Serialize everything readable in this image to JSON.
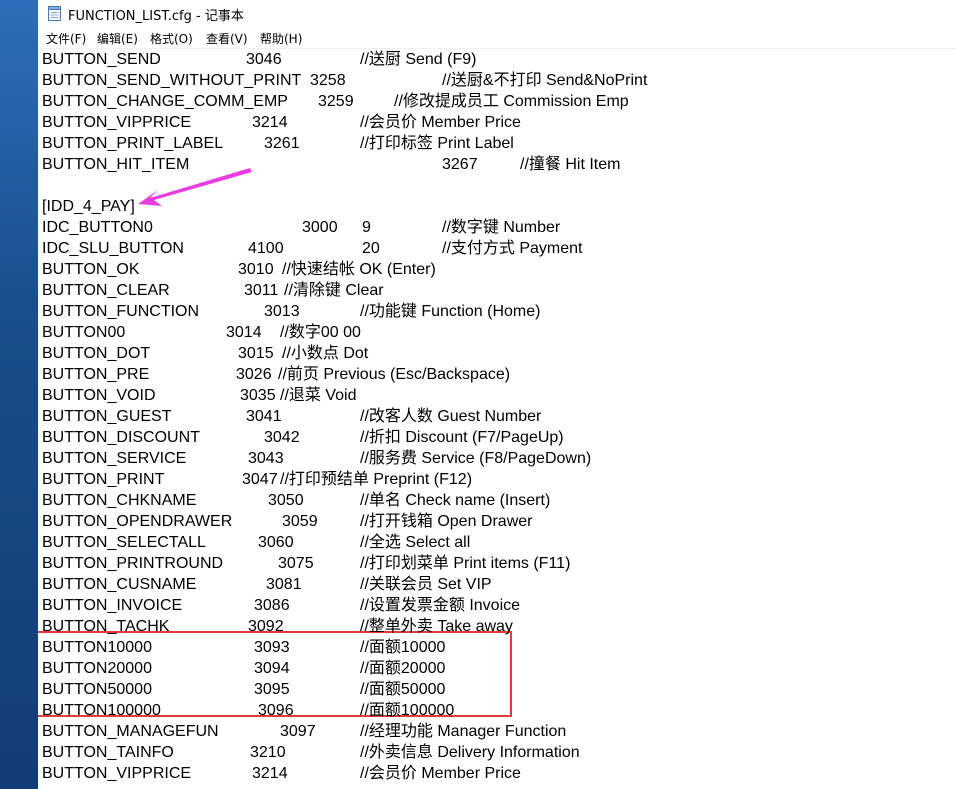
{
  "window": {
    "title": "FUNCTION_LIST.cfg - 记事本"
  },
  "menu": [
    "文件(F)",
    "编辑(E)",
    "格式(O)",
    "查看(V)",
    "帮助(H)"
  ],
  "lines": [
    [
      "BUTTON_SEND",
      "3046",
      "",
      "//送厨 Send (F9)"
    ],
    [
      "BUTTON_SEND_WITHOUT_PRINT",
      "3258",
      "",
      "//送厨&不打印 Send&NoPrint"
    ],
    [
      "BUTTON_CHANGE_COMM_EMP",
      "3259",
      "",
      "//修改提成员工 Commission Emp"
    ],
    [
      "BUTTON_VIPPRICE",
      "3214",
      "",
      "//会员价  Member Price"
    ],
    [
      "BUTTON_PRINT_LABEL",
      "3261",
      "",
      "//打印标签 Print Label"
    ],
    [
      "BUTTON_HIT_ITEM",
      "3267",
      "",
      "//撞餐 Hit Item"
    ],
    [
      "",
      "",
      "",
      ""
    ],
    [
      "[IDD_4_PAY]",
      "",
      "",
      ""
    ],
    [
      "IDC_BUTTON0",
      "3000",
      "9",
      "//数字键 Number"
    ],
    [
      "IDC_SLU_BUTTON",
      "4100",
      "20",
      "//支付方式 Payment"
    ],
    [
      "BUTTON_OK",
      "3010",
      "",
      "//快速结帐  OK (Enter)"
    ],
    [
      "BUTTON_CLEAR",
      "3011",
      "",
      "//清除键  Clear"
    ],
    [
      "BUTTON_FUNCTION",
      "3013",
      "",
      "//功能键  Function (Home)"
    ],
    [
      "BUTTON00",
      "3014",
      "",
      "//数字00  00"
    ],
    [
      "BUTTON_DOT",
      "3015",
      "",
      "//小数点  Dot"
    ],
    [
      "BUTTON_PRE",
      "3026",
      "",
      "//前页   Previous (Esc/Backspace)"
    ],
    [
      "BUTTON_VOID",
      "3035",
      "",
      "//退菜  Void"
    ],
    [
      "BUTTON_GUEST",
      "3041",
      "",
      "//改客人数  Guest Number"
    ],
    [
      "BUTTON_DISCOUNT",
      "3042",
      "",
      "//折扣  Discount (F7/PageUp)"
    ],
    [
      "BUTTON_SERVICE",
      "3043",
      "",
      "//服务费  Service (F8/PageDown)"
    ],
    [
      "BUTTON_PRINT",
      "3047",
      "",
      "//打印预结单 Preprint (F12)"
    ],
    [
      "BUTTON_CHKNAME",
      "3050",
      "",
      "//单名   Check name (Insert)"
    ],
    [
      "BUTTON_OPENDRAWER",
      "3059",
      "",
      "//打开钱箱 Open Drawer"
    ],
    [
      "BUTTON_SELECTALL",
      "3060",
      "",
      "//全选 Select all"
    ],
    [
      "BUTTON_PRINTROUND",
      "3075",
      "",
      "//打印划菜单 Print items (F11)"
    ],
    [
      "BUTTON_CUSNAME",
      "3081",
      "",
      "//关联会员 Set VIP"
    ],
    [
      "BUTTON_INVOICE",
      "3086",
      "",
      "//设置发票金额 Invoice"
    ],
    [
      "BUTTON_TACHK",
      "3092",
      "",
      "//整单外卖  Take away"
    ],
    [
      "BUTTON10000",
      "3093",
      "",
      "//面额10000"
    ],
    [
      "BUTTON20000",
      "3094",
      "",
      "//面额20000"
    ],
    [
      "BUTTON50000",
      "3095",
      "",
      "//面额50000"
    ],
    [
      "BUTTON100000",
      "3096",
      "",
      "//面额100000"
    ],
    [
      "BUTTON_MANAGEFUN",
      "3097",
      "",
      "//经理功能  Manager Function"
    ],
    [
      "BUTTON_TAINFO",
      "3210",
      "",
      "//外卖信息 Delivery Information"
    ],
    [
      "BUTTON_VIPPRICE",
      "3214",
      "",
      "//会员价  Member Price"
    ]
  ],
  "colors": {
    "highlight_box": "#e03c3c",
    "arrow": "#e83ee0"
  }
}
